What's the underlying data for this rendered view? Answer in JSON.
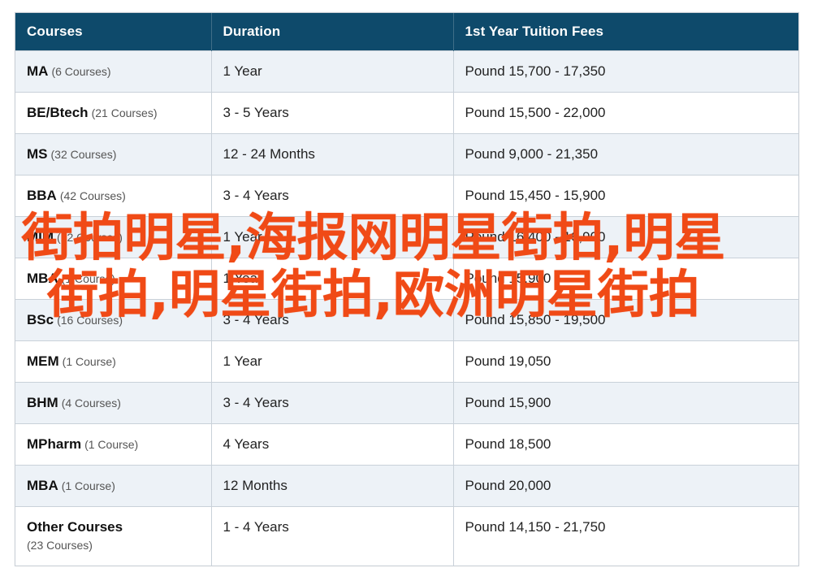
{
  "table": {
    "headers": [
      "Courses",
      "Duration",
      "1st Year Tuition Fees"
    ],
    "rows": [
      {
        "name": "MA",
        "count": "(6 Courses)",
        "duration": "1 Year",
        "fees": "Pound 15,700 - 17,350"
      },
      {
        "name": "BE/Btech",
        "count": "(21 Courses)",
        "duration": "3 - 5 Years",
        "fees": "Pound 15,500 - 22,000"
      },
      {
        "name": "MS",
        "count": "(32 Courses)",
        "duration": "12 - 24 Months",
        "fees": "Pound 9,000 - 21,350"
      },
      {
        "name": "BBA",
        "count": "(42 Courses)",
        "duration": "3 - 4 Years",
        "fees": "Pound 15,450 - 15,900"
      },
      {
        "name": "MIM",
        "count": "(22 Courses)",
        "duration": "1 Year",
        "fees": "Pound 16,400 - 16,900"
      },
      {
        "name": "MBA",
        "count": "(1 Course)",
        "duration": "1 Year",
        "fees": "Pound 15,900"
      },
      {
        "name": "BSc",
        "count": "(16 Courses)",
        "duration": "3 - 4 Years",
        "fees": "Pound 15,850 - 19,500"
      },
      {
        "name": "MEM",
        "count": "(1 Course)",
        "duration": "1 Year",
        "fees": "Pound 19,050"
      },
      {
        "name": "BHM",
        "count": "(4 Courses)",
        "duration": "3 - 4 Years",
        "fees": "Pound 15,900"
      },
      {
        "name": "MPharm",
        "count": "(1 Course)",
        "duration": "4 Years",
        "fees": "Pound 18,500"
      },
      {
        "name": "MBA",
        "count": "(1 Course)",
        "duration": "12 Months",
        "fees": "Pound 20,000"
      },
      {
        "name": "Other Courses",
        "count": "(23 Courses)",
        "duration": "1 - 4 Years",
        "fees": "Pound 14,150 - 21,750"
      }
    ]
  },
  "watermark": {
    "text": "街拍明星,海报网明星街拍,明星街拍,明星街拍,欧洲明星街拍",
    "color": "#f04a16"
  },
  "colors": {
    "header_bg": "#0e4a6b",
    "row_alt_bg": "#edf2f7"
  }
}
